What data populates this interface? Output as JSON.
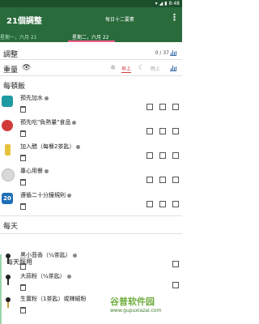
{
  "status": {
    "time": "8:48"
  },
  "appbar": {
    "title": "21個調整",
    "action": "每日十二要素",
    "more": "⋮"
  },
  "dates": {
    "prev": "星期一，六月 21",
    "current": "星期二，六月 22"
  },
  "adjust": {
    "title": "調整",
    "count": "0 / 37"
  },
  "weight": {
    "label": "重量",
    "am": "早上",
    "pm": "晚上"
  },
  "sections": {
    "per_meal": "每頓飯",
    "daily": "每天",
    "daily_sub": "每天服用"
  },
  "meal_items": [
    {
      "name": "預先加水",
      "color": "#1e9aa2"
    },
    {
      "name": "預先吃\"負熱量\"食品",
      "color": "#d23a3a"
    },
    {
      "name": "加入醋（每餐2茶匙）",
      "color": "#e7c23b"
    },
    {
      "name": "專心用餐",
      "color": "#c9c9c9"
    },
    {
      "name": "遵循二十分鐘規則",
      "color": "#1f6fb8",
      "icon_text": "20"
    }
  ],
  "daily_items": [
    {
      "name": "黑小茴香（¼茶匙）"
    },
    {
      "name": "大蒜粉（¼茶匙）"
    },
    {
      "name": "生薑粉（1茶匙）或辣椒粉"
    }
  ],
  "watermark": {
    "main": "谷普软件园",
    "url": "www.gupuxiazai.com"
  }
}
